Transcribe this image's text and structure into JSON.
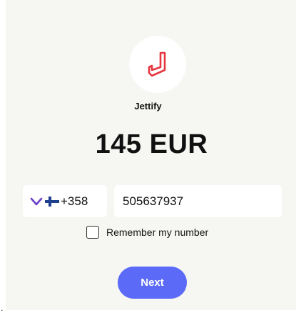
{
  "merchant": {
    "name": "Jettify",
    "logo_icon": "jettify-logo-icon",
    "logo_color": "#e5363f"
  },
  "payment": {
    "amount": "145 EUR"
  },
  "phone": {
    "country_flag_icon": "finland-flag-icon",
    "dial_code": "+358",
    "number": "505637937"
  },
  "remember": {
    "label": "Remember my number",
    "checked": false
  },
  "actions": {
    "next_label": "Next"
  },
  "page": {
    "corner_mark": "."
  },
  "colors": {
    "background": "#f6f6f2",
    "button": "#5b6bf8",
    "chevron": "#6a3fc8",
    "flag_blue": "#1f3f8f"
  }
}
